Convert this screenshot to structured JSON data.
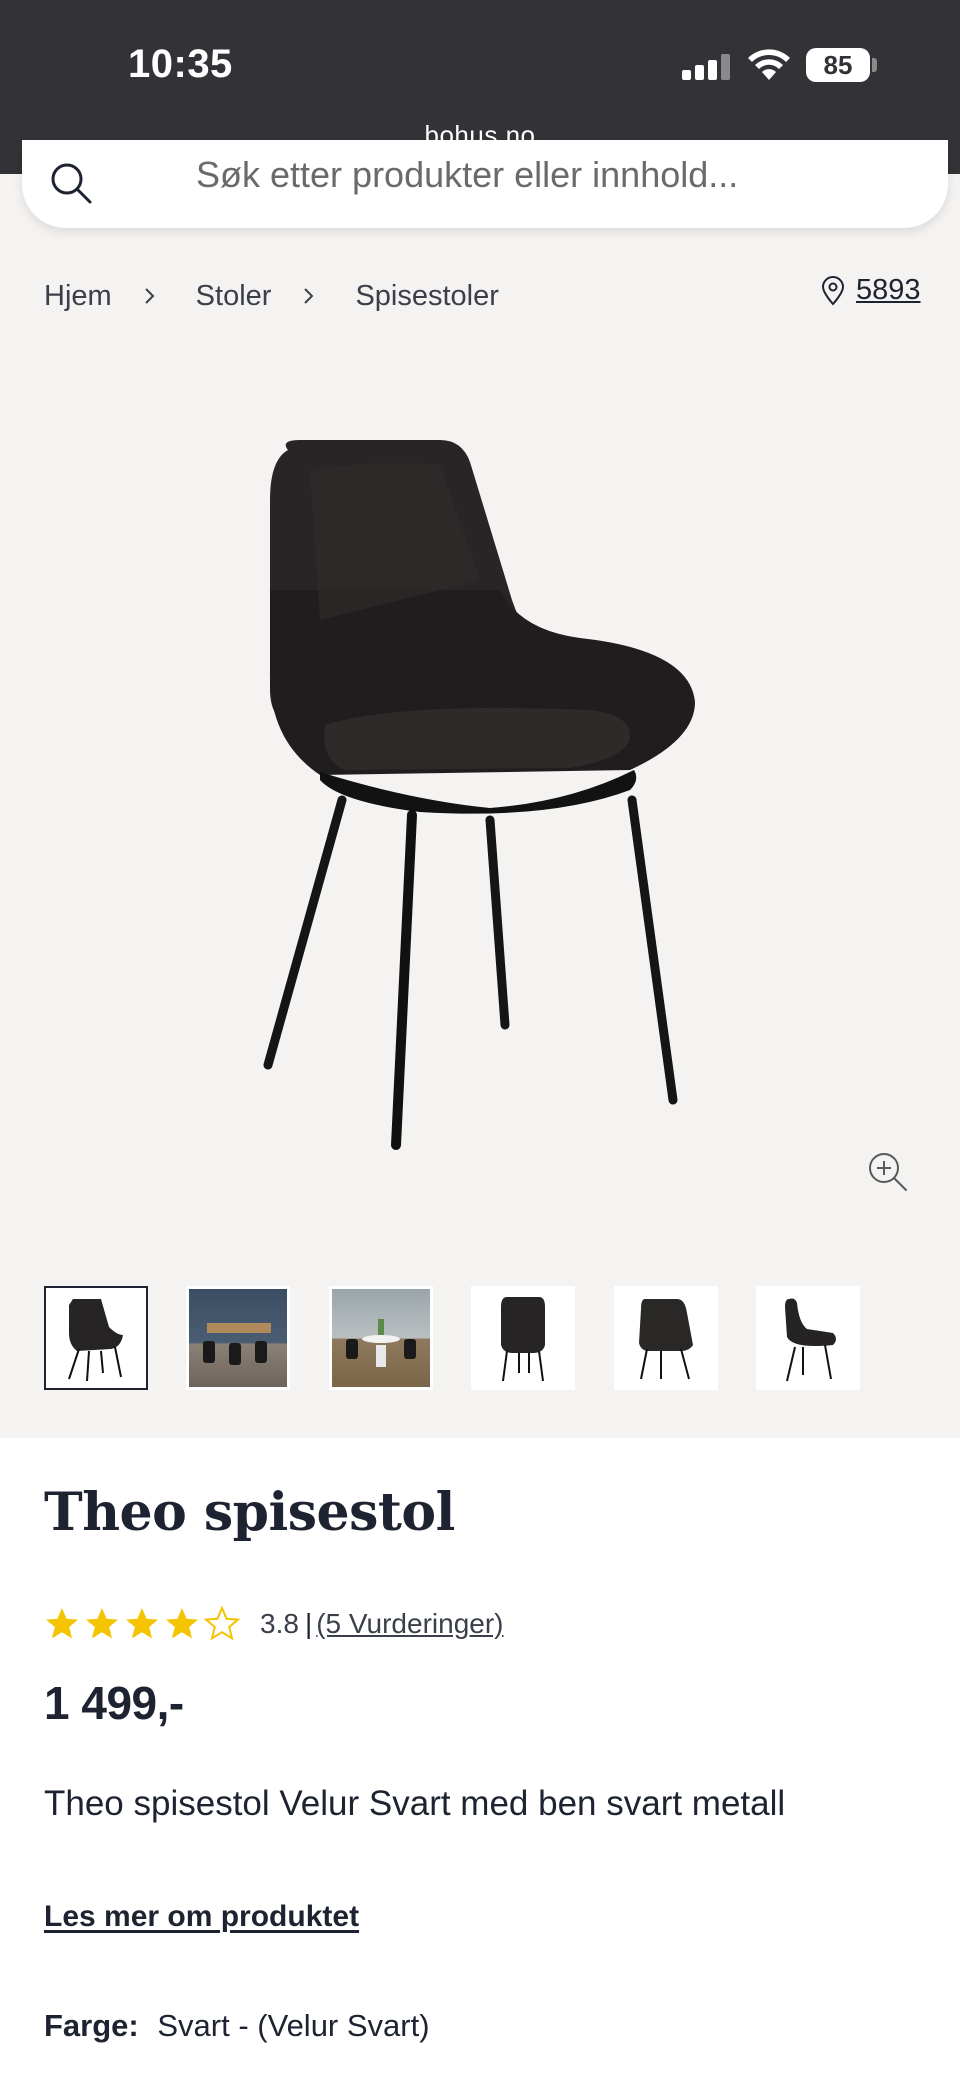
{
  "status_bar": {
    "time": "10:35",
    "battery": "85",
    "url": "bohus.no"
  },
  "search": {
    "placeholder": "Søk etter produkter eller innhold..."
  },
  "breadcrumb": {
    "items": [
      "Hjem",
      "Stoler",
      "Spisestoler"
    ]
  },
  "store": {
    "number": "5893"
  },
  "product": {
    "title": "Theo spisestol",
    "rating_value": "3.8",
    "rating_separator": "|",
    "rating_link": "(5 Vurderinger)",
    "rating_stars": 3.8,
    "price": "1 499,-",
    "description": "Theo spisestol Velur Svart med ben svart metall",
    "read_more": "Les mer om produktet",
    "color_label": "Farge:",
    "color_value": "Svart - (Velur Svart)"
  },
  "gallery": {
    "thumbnail_count": 6,
    "active_index": 0
  },
  "colors": {
    "status_bar": "#333337",
    "gallery_bg": "#f5f3f1",
    "star": "#f5c400",
    "text": "#1d2330"
  },
  "icons": {
    "search": "search-icon",
    "chevron": "chevron-right-icon",
    "pin": "location-pin-icon",
    "zoom": "zoom-in-icon",
    "star": "star-icon"
  }
}
